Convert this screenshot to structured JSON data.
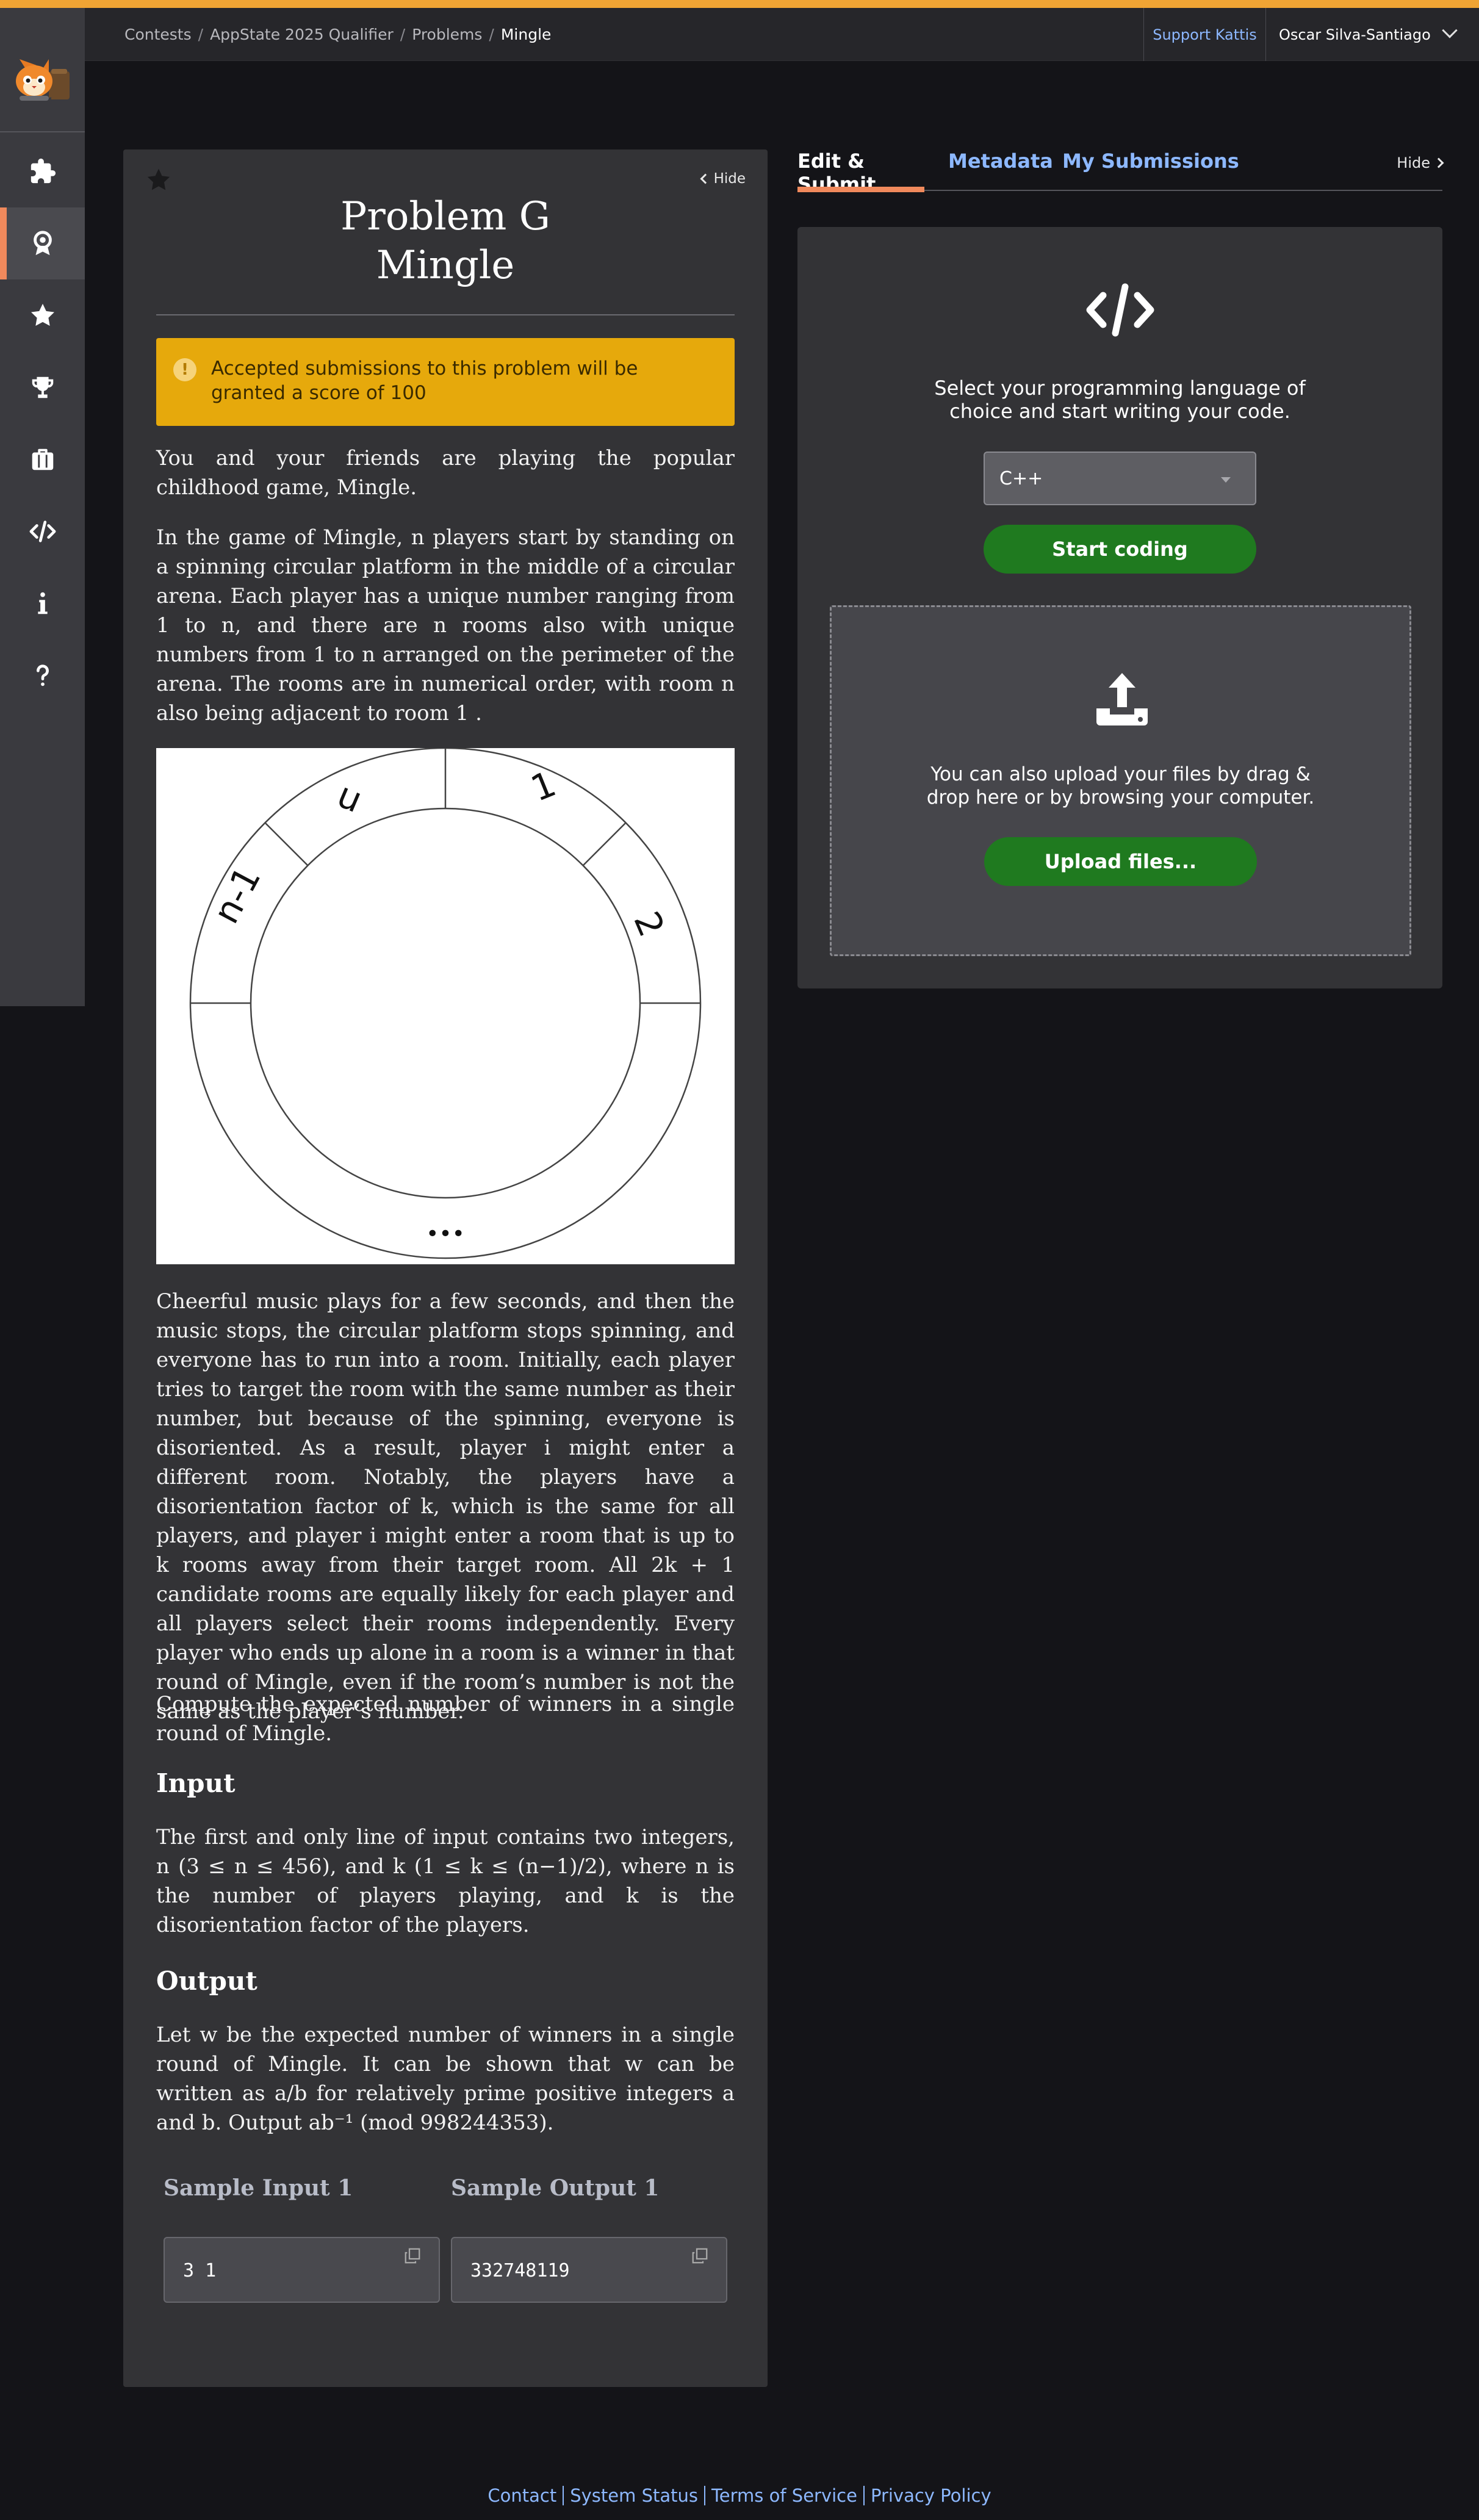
{
  "colors": {
    "accent": "#f0895c",
    "top_stripe": "#f0a434",
    "link": "#8db8ff",
    "notice_bg": "#e6a90c",
    "button_green": "#1f7a1f"
  },
  "breadcrumb": [
    "Contests",
    "AppState 2025 Qualifier",
    "Problems",
    "Mingle"
  ],
  "header": {
    "support": "Support Kattis",
    "user": "Oscar Silva-Santiago"
  },
  "sidebar": {
    "icons": [
      "puzzle-icon",
      "badge-icon",
      "star-icon",
      "trophy-icon",
      "briefcase-icon",
      "code-icon",
      "info-icon",
      "help-icon"
    ],
    "active_index": 1
  },
  "problem": {
    "hide": "Hide",
    "title_line1": "Problem G",
    "title_line2": "Mingle",
    "notice": "Accepted submissions to this problem will be granted a score of 100",
    "p1": "You and your friends are playing the popular childhood game, Mingle.",
    "p2": "In the game of Mingle, n players start by standing on a spinning circular platform in the middle of a circular arena. Each player has a unique number ranging from 1 to n, and there are n rooms also with unique numbers from 1 to n arranged on the perimeter of the arena. The rooms are in numerical order, with room n also being adjacent to room 1 .",
    "figure_labels": {
      "n": "n",
      "one": "1",
      "two": "2",
      "n_minus_1": "n-1",
      "dots": "•••"
    },
    "p3": "Cheerful music plays for a few seconds, and then the music stops, the circular platform stops spinning, and everyone has to run into a room. Initially, each player tries to target the room with the same number as their number, but because of the spinning, everyone is disoriented. As a result, player i might enter a different room. Notably, the players have a disorientation factor of k, which is the same for all players, and player i might enter a room that is up to k rooms away from their target room. All 2k + 1 candidate rooms are equally likely for each player and all players select their rooms independently. Every player who ends up alone in a room is a winner in that round of Mingle, even if the room’s number is not the same as the player’s number.",
    "p4": "Compute the expected number of winners in a single round of Mingle.",
    "input_heading": "Input",
    "input_text": "The first and only line of input contains two integers, n (3 ≤ n ≤ 456), and k (1 ≤ k ≤ (n−1)/2), where n is the number of players playing, and k is the disorientation factor of the players.",
    "output_heading": "Output",
    "output_text": "Let w be the expected number of winners in a single round of Mingle. It can be shown that w can be written as a/b for relatively prime positive integers a and b. Output ab⁻¹ (mod 998244353).",
    "sample_input_label": "Sample Input 1",
    "sample_output_label": "Sample Output 1",
    "sample_input": "3 1",
    "sample_output": "332748119"
  },
  "submit": {
    "tabs": [
      "Edit & Submit",
      "Metadata",
      "My Submissions"
    ],
    "active_tab": 0,
    "hide": "Hide",
    "select_text_line1": "Select your programming language of",
    "select_text_line2": "choice and start writing your code.",
    "language": "C++",
    "start_coding": "Start coding",
    "upload_text_line1": "You can also upload your files by drag &",
    "upload_text_line2": "drop here or by browsing your computer.",
    "upload_button": "Upload files..."
  },
  "footer": [
    "Contact",
    "System Status",
    "Terms of Service",
    "Privacy Policy"
  ]
}
